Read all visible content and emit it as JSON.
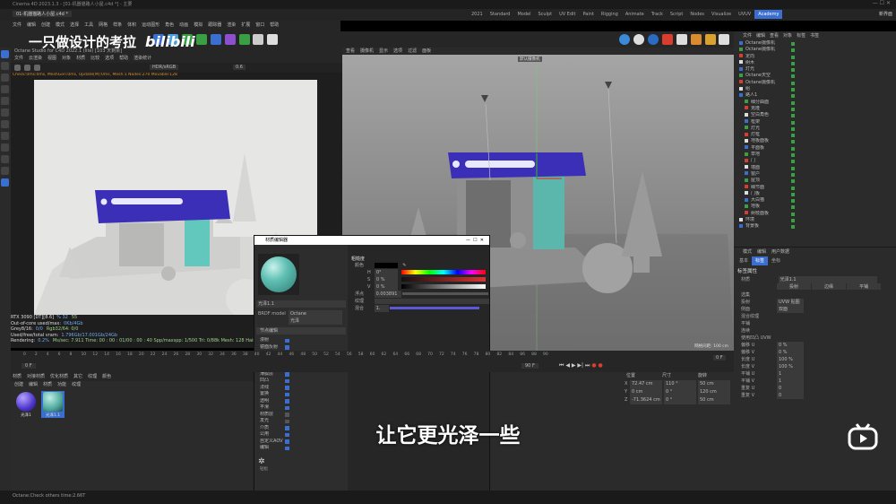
{
  "window": {
    "title": "Cinema 4D 2023.1.3 - [01-机器猫路人小屋.c4d *] - 主要",
    "doc_tab": "01-机器猫路人小屋.c4d *"
  },
  "layout_tabs": [
    "2021",
    "Standard",
    "Model",
    "Sculpt",
    "UV Edit",
    "Paint",
    "Rigging",
    "Animate",
    "Track",
    "Script",
    "Nodes",
    "Visualize",
    "UVUV",
    "Academy"
  ],
  "layout_active": "Academy",
  "right_top_label": "新界面",
  "watermark": {
    "text": "一只做设计的考拉",
    "logo": "bilibili"
  },
  "menu_left": [
    "文件",
    "编辑",
    "创建",
    "模式",
    "选择",
    "工具",
    "网格",
    "样条",
    "体积",
    "运动图形",
    "角色",
    "动画",
    "模拟",
    "跟踪器",
    "渲染",
    "扩展",
    "窗口",
    "帮助"
  ],
  "octane_viewer": {
    "title": "Octane Studio for C4D 2022.1 (lite) [103 天剩余]",
    "menu": [
      "文件",
      "云渲染",
      "视图",
      "对象",
      "材质",
      "比较",
      "选项",
      "帮助",
      "渲染统计"
    ],
    "mode": "HDR/sRGB",
    "value": "0.6",
    "status": "Check:0ms:0ms, MeshGen:0ms, Update[M]:0ms, Mesh:1 Nodes:270 Movable:128",
    "resolution": "2000*2000 ZOOM:31%",
    "stats": [
      {
        "k": "RTX 3090 [DT][8.6]",
        "v": "% 32",
        "v2": "55"
      },
      {
        "k": "Out-of-core used/max:",
        "v": "0Kb/4Gb",
        "v2": ""
      },
      {
        "k": "Grey8/16:",
        "v": "0/0",
        "v2": "Rgb32/64: 0/0"
      },
      {
        "k": "Used/free/total vram:",
        "v": "1.796Gb/17.001Gb/24Gb",
        "v2": ""
      },
      {
        "k": "Rendering:",
        "v": "0.2%",
        "v2": "Ms/sec: 7.911  Time: 00 : 00 : 01/00 : 00 : 40  Spp/maxspp: 1/500  Tri: 0/88k  Mesh: 128  Hair: 0"
      }
    ],
    "frame": "0 F"
  },
  "viewport": {
    "menu": [
      "查看",
      "摄像机",
      "显示",
      "选项",
      "过滤",
      "面板"
    ],
    "camera_tag": "默认摄像机",
    "grid_label": "网格间距: 100 cm"
  },
  "material_editor": {
    "title": "材质编辑器",
    "material_name": "光泽1.1",
    "top_fields": [
      {
        "label": "BRDF model",
        "value": "Octane"
      },
      {
        "label": "",
        "value": "光泽"
      }
    ],
    "section": "节点编辑",
    "channels": [
      {
        "name": "漫射",
        "on": true
      },
      {
        "name": "镜面反射",
        "on": true
      },
      {
        "name": "粗糙度",
        "on": true,
        "active": true
      },
      {
        "name": "各向异性",
        "on": true
      },
      {
        "name": "光泽层",
        "on": true
      },
      {
        "name": "薄膜层",
        "on": true
      },
      {
        "name": "凹凸",
        "on": true
      },
      {
        "name": "法线",
        "on": true
      },
      {
        "name": "置换",
        "on": true
      },
      {
        "name": "透明",
        "on": true
      },
      {
        "name": "平滑",
        "on": true
      },
      {
        "name": "材质层",
        "on": false
      },
      {
        "name": "发光",
        "on": false
      },
      {
        "name": "介质",
        "on": true
      },
      {
        "name": "公用",
        "on": true
      },
      {
        "name": "自定义AOV",
        "on": true
      },
      {
        "name": "编辑",
        "on": true
      }
    ],
    "right_header": "粗糙度",
    "color_label": "颜色",
    "hsv": [
      {
        "k": "H",
        "v": "0°"
      },
      {
        "k": "S",
        "v": "0 %"
      },
      {
        "k": "V",
        "v": "0 %"
      }
    ],
    "float_label": "浮点",
    "float_value": "0.003891",
    "texture_label": "纹理",
    "mix_label": "混合",
    "mix_value": "1.",
    "logo_label": "轻松"
  },
  "subtitle": "让它更光泽一些",
  "timeline": {
    "ticks": [
      "0",
      "2",
      "4",
      "6",
      "8",
      "10",
      "12",
      "14",
      "16",
      "18",
      "20",
      "22",
      "24",
      "26",
      "28",
      "30",
      "32",
      "34",
      "36",
      "38",
      "40",
      "42",
      "44",
      "46",
      "48",
      "50",
      "52",
      "54",
      "56",
      "58",
      "60",
      "62",
      "64",
      "66",
      "68",
      "70",
      "72",
      "74",
      "76",
      "78",
      "80",
      "82",
      "84",
      "86",
      "88",
      "90"
    ],
    "start": "0 F",
    "end": "90 F",
    "current": "0 F",
    "end_right": "90 F"
  },
  "material_manager": {
    "menu": [
      "创建",
      "编辑",
      "材质",
      "功能",
      "纹理"
    ],
    "tabs": [
      "材质",
      "对接材质",
      "优化材质",
      "其它",
      "纹理",
      "颜色"
    ],
    "items": [
      {
        "name": "光泽1"
      },
      {
        "name": "光泽1.1"
      }
    ]
  },
  "coordinates": {
    "headers": [
      "位置",
      "尺寸",
      "旋转"
    ],
    "rows": [
      {
        "axis": "X",
        "pos": "72.47 cm",
        "size": "110 °",
        "rot": "50 cm"
      },
      {
        "axis": "Y",
        "pos": "0 cm",
        "size": "0 °",
        "rot": "120 cm"
      },
      {
        "axis": "Z",
        "pos": "-71.3624 cm",
        "size": "0 °",
        "rot": "50 cm"
      }
    ]
  },
  "status_bar": "Octane:Check others time:2.66T",
  "object_manager": {
    "menu": [
      "文件",
      "编辑",
      "查看",
      "对象",
      "标签",
      "书签"
    ],
    "items": [
      {
        "name": "Octane摄像机",
        "indent": 0
      },
      {
        "name": "Octane摄像机",
        "indent": 0
      },
      {
        "name": "定向",
        "indent": 0
      },
      {
        "name": "树木",
        "indent": 0
      },
      {
        "name": "灯光",
        "indent": 0
      },
      {
        "name": "Octane天空",
        "indent": 0
      },
      {
        "name": "Octane摄像机",
        "indent": 0
      },
      {
        "name": "组",
        "indent": 0
      },
      {
        "name": "路人1",
        "indent": 0
      },
      {
        "name": "细分曲面",
        "indent": 1
      },
      {
        "name": "克隆",
        "indent": 1
      },
      {
        "name": "空白角色",
        "indent": 1
      },
      {
        "name": "框架",
        "indent": 1
      },
      {
        "name": "灯光",
        "indent": 1
      },
      {
        "name": "灯框",
        "indent": 1
      },
      {
        "name": "地板面板",
        "indent": 1
      },
      {
        "name": "平面板",
        "indent": 1
      },
      {
        "name": "草地",
        "indent": 1
      },
      {
        "name": "门",
        "indent": 1
      },
      {
        "name": "墙面",
        "indent": 1
      },
      {
        "name": "窗户",
        "indent": 1
      },
      {
        "name": "屋顶",
        "indent": 1
      },
      {
        "name": "细节面",
        "indent": 1
      },
      {
        "name": "门板",
        "indent": 1
      },
      {
        "name": "大白猫",
        "indent": 1
      },
      {
        "name": "地板",
        "indent": 1
      },
      {
        "name": "树枝面板",
        "indent": 1
      },
      {
        "name": "环境",
        "indent": 0
      },
      {
        "name": "背景板",
        "indent": 0
      }
    ]
  },
  "attributes": {
    "menu": [
      "模式",
      "编辑",
      "用户数据"
    ],
    "tabs": [
      "基本",
      "标签",
      "坐标"
    ],
    "active_tab": "标签",
    "section": "标签属性",
    "material_field": {
      "label": "材质",
      "value": "光泽1.1"
    },
    "rows": [
      {
        "label": "选集",
        "value": ""
      },
      {
        "label": "投射",
        "value": "UVW 贴图"
      },
      {
        "label": "侧面",
        "value": "双面"
      },
      {
        "label": "混合纹理",
        "value": ""
      },
      {
        "label": "平铺",
        "value": ""
      },
      {
        "label": "连续",
        "value": ""
      },
      {
        "label": "使用凹凸 UVW",
        "value": ""
      },
      {
        "label": "偏移 U",
        "value": "0 %"
      },
      {
        "label": "偏移 V",
        "value": "0 %"
      },
      {
        "label": "长度 U",
        "value": "100 %"
      },
      {
        "label": "长度 V",
        "value": "100 %"
      },
      {
        "label": "平铺 U",
        "value": "1"
      },
      {
        "label": "平铺 V",
        "value": "1"
      },
      {
        "label": "重复 U",
        "value": "0"
      },
      {
        "label": "重复 V",
        "value": "0"
      }
    ],
    "mode_buttons": [
      "投射",
      "边缘",
      "平铺"
    ]
  },
  "colors": {
    "accent": "#3a6fd1",
    "roof": "#3b2fb8",
    "door": "#62c7bd",
    "panel": "#2b2b2b",
    "material_preview": "#5fbfb3"
  }
}
